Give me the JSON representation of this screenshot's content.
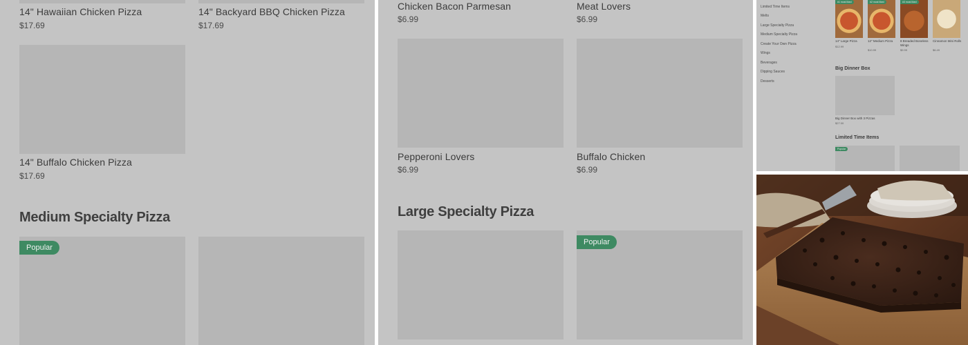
{
  "left_panel": {
    "items_top": [
      {
        "name": "14\" Hawaiian Chicken Pizza",
        "price": "$17.69"
      },
      {
        "name": "14\" Backyard BBQ Chicken Pizza",
        "price": "$17.69"
      },
      {
        "name": "14\" Buffalo Chicken Pizza",
        "price": "$17.69"
      }
    ],
    "section_heading": "Medium Specialty Pizza",
    "badge": "Popular"
  },
  "middle_panel": {
    "items_top": [
      {
        "name": "Chicken Bacon Parmesan",
        "price": "$6.99"
      },
      {
        "name": "Meat Lovers",
        "price": "$6.99"
      },
      {
        "name": "Pepperoni Lovers",
        "price": "$6.99"
      },
      {
        "name": "Buffalo Chicken",
        "price": "$6.99"
      }
    ],
    "section_heading": "Large Specialty Pizza",
    "badge": "Popular"
  },
  "thumbnail": {
    "sidebar": [
      "Limited Time Items",
      "Melts",
      "Large Specialty Pizza",
      "Medium Specialty Pizza",
      "Create Your Own Pizza",
      "Wings",
      "Beverages",
      "Dipping Sauces",
      "Desserts"
    ],
    "top_items": [
      {
        "name": "14\" Large Pizza",
        "price": "$12.99",
        "badge": "#1 most liked"
      },
      {
        "name": "12\" Medium Pizza",
        "price": "$10.99",
        "badge": "#2 most liked"
      },
      {
        "name": "8 Breaded Boneless Wings",
        "price": "$9.99",
        "badge": "#3 most liked"
      },
      {
        "name": "Cinnamon Mini Rolls",
        "price": "$6.49",
        "badge": ""
      }
    ],
    "big_dinner_heading": "Big Dinner Box",
    "big_dinner_item": {
      "name": "Big Dinner Box with 3 Pizzas",
      "price": "$27.00"
    },
    "limited_heading": "Limited Time Items",
    "limited_badge": "Popular"
  },
  "photo": {
    "subject": "chocolate-chip-brownie-tray",
    "colors": {
      "wood": "#6b4128",
      "brownie": "#3a2218",
      "napkin": "#b9aa92",
      "plate": "#d9d5cf"
    }
  },
  "colors": {
    "overlay": "#c4c4c4",
    "placeholder": "#b6b6b6",
    "badge": "#3e8a62",
    "text": "#3b3b3b"
  }
}
